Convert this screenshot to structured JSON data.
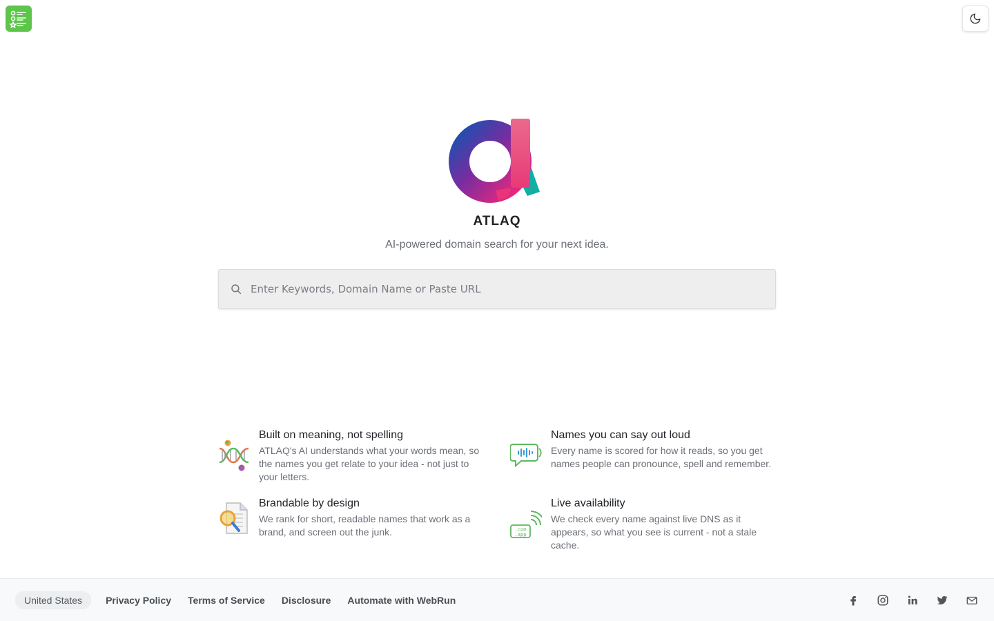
{
  "header": {
    "app_icon": "checklist-app-icon",
    "theme_toggle_icon": "moon-icon"
  },
  "hero": {
    "brand_name": "ATLAQ",
    "tagline": "AI-powered domain search for your next idea."
  },
  "search": {
    "placeholder": "Enter Keywords, Domain Name or Paste URL",
    "value": ""
  },
  "features": [
    {
      "icon": "dna-icon",
      "title": "Built on meaning, not spelling",
      "description": "ATLAQ's AI understands what your words mean, so the names you get relate to your idea - not just to your letters."
    },
    {
      "icon": "speech-bubble-icon",
      "title": "Names you can say out loud",
      "description": "Every name is scored for how it reads, so you get names people can pronounce, spell and remember."
    },
    {
      "icon": "document-magnifier-icon",
      "title": "Brandable by design",
      "description": "We rank for short, readable names that work as a brand, and screen out the junk."
    },
    {
      "icon": "domain-signal-icon",
      "title": "Live availability",
      "description": "We check every name against live DNS as it appears, so what you see is current - not a stale cache."
    }
  ],
  "footer": {
    "region": "United States",
    "links": [
      "Privacy Policy",
      "Terms of Service",
      "Disclosure",
      "Automate with WebRun"
    ]
  },
  "domain_icon_labels": [
    ".com",
    ".app"
  ],
  "colors": {
    "app_badge": "#5cc54a",
    "search_bg": "#eeeeee",
    "footer_bg": "#f8f9fa"
  }
}
